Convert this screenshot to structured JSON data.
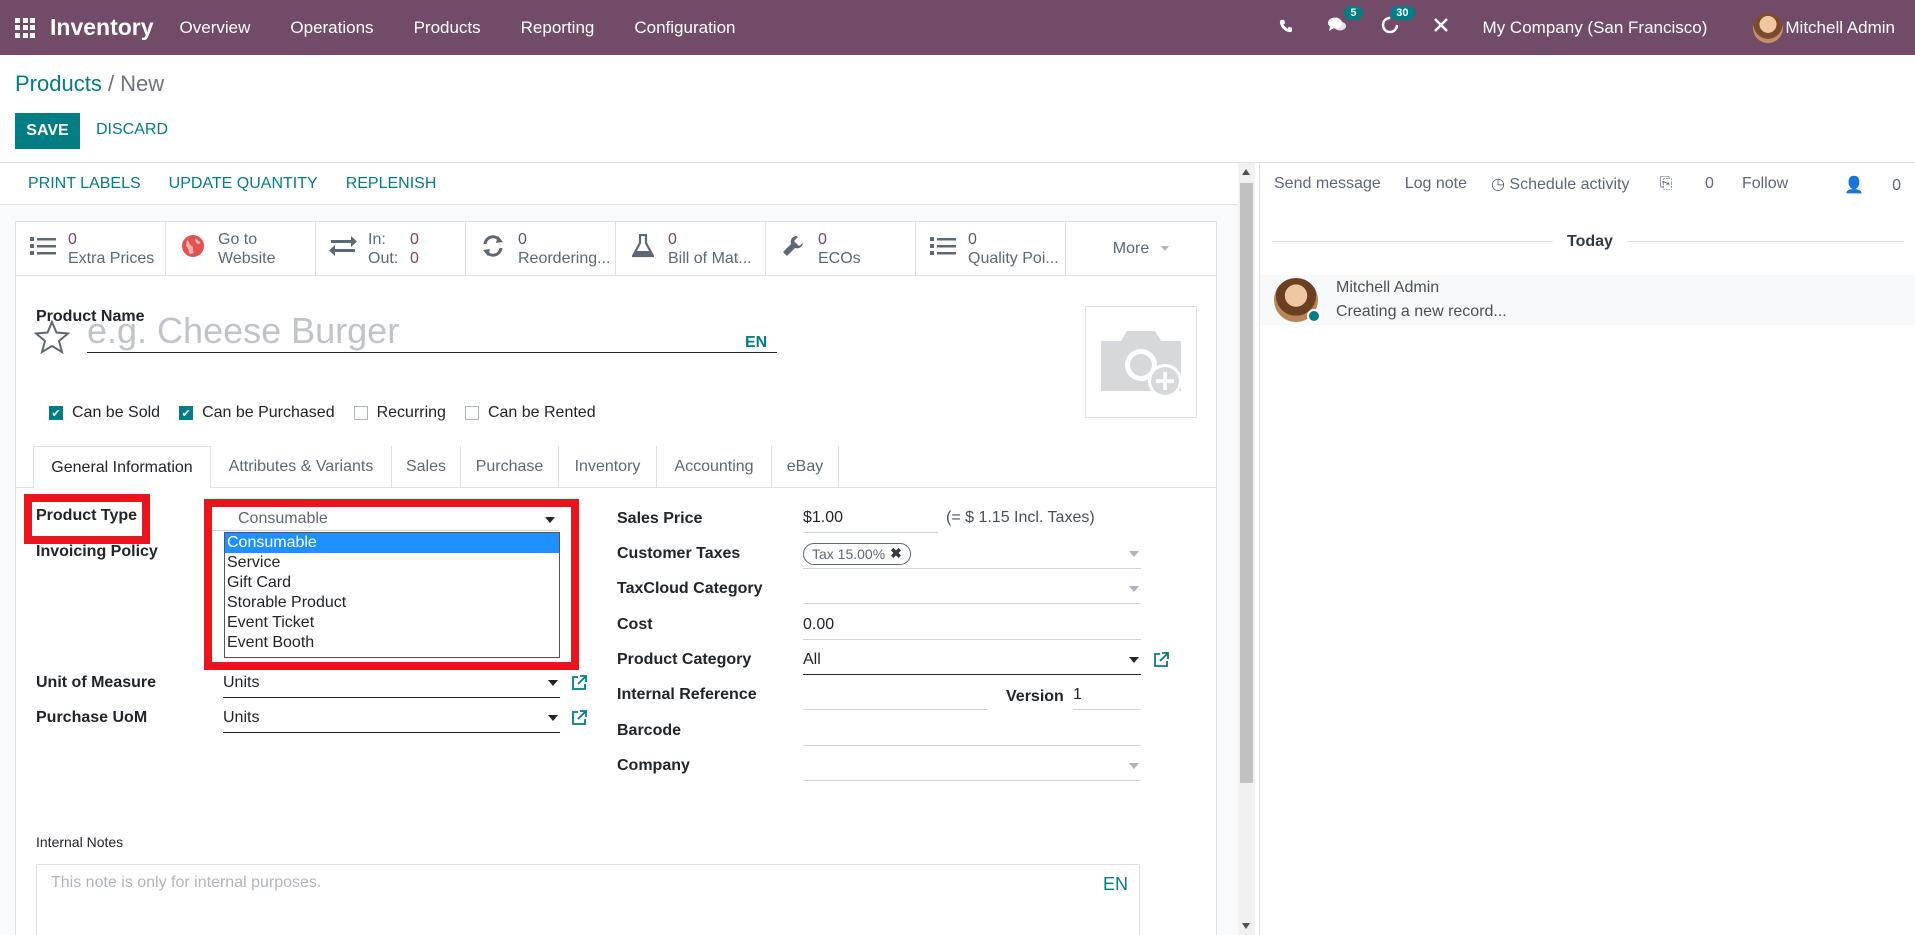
{
  "navbar": {
    "app_name": "Inventory",
    "menu": [
      "Overview",
      "Operations",
      "Products",
      "Reporting",
      "Configuration"
    ],
    "messages_count": "5",
    "activities_count": "30",
    "company": "My Company (San Francisco)",
    "user": "Mitchell Admin",
    "bg_color": "#714b67"
  },
  "breadcrumb": {
    "parent": "Products",
    "separator": " / ",
    "current": "New"
  },
  "buttons": {
    "save": "SAVE",
    "discard": "DISCARD"
  },
  "statusbar": {
    "print_labels": "PRINT LABELS",
    "update_quantity": "UPDATE QUANTITY",
    "replenish": "REPLENISH"
  },
  "smart_buttons": {
    "extra_prices": {
      "value": "0",
      "label": "Extra Prices"
    },
    "website": {
      "line1": "Go to",
      "line2": "Website"
    },
    "inout": {
      "in_label": "In:",
      "in_value": "0",
      "out_label": "Out:",
      "out_value": "0"
    },
    "reordering": {
      "value": "0",
      "label": "Reordering..."
    },
    "bom": {
      "value": "0",
      "label": "Bill of Mat..."
    },
    "ecos": {
      "value": "0",
      "label": "ECOs"
    },
    "quality": {
      "value": "0",
      "label": "Quality Poi..."
    },
    "more": "More"
  },
  "form": {
    "product_name_label": "Product Name",
    "product_name_placeholder": "e.g. Cheese Burger",
    "lang": "EN",
    "checkboxes": [
      {
        "label": "Can be Sold",
        "checked": true
      },
      {
        "label": "Can be Purchased",
        "checked": true
      },
      {
        "label": "Recurring",
        "checked": false
      },
      {
        "label": "Can be Rented",
        "checked": false
      }
    ],
    "tabs": [
      "General Information",
      "Attributes & Variants",
      "Sales",
      "Purchase",
      "Inventory",
      "Accounting",
      "eBay"
    ],
    "left": {
      "product_type_label": "Product Type",
      "product_type_value": "Consumable",
      "product_type_options": [
        "Consumable",
        "Service",
        "Gift Card",
        "Storable Product",
        "Event Ticket",
        "Event Booth"
      ],
      "invoicing_policy_label": "Invoicing Policy",
      "uom_label": "Unit of Measure",
      "uom_value": "Units",
      "purchase_uom_label": "Purchase UoM",
      "purchase_uom_value": "Units"
    },
    "right": {
      "sales_price_label": "Sales Price",
      "sales_price_value": "$1.00",
      "sales_price_incl": "(= $ 1.15 Incl. Taxes)",
      "customer_taxes_label": "Customer Taxes",
      "customer_taxes_tag": "Tax 15.00%",
      "taxcloud_label": "TaxCloud Category",
      "cost_label": "Cost",
      "cost_value": "0.00",
      "category_label": "Product Category",
      "category_value": "All",
      "internal_ref_label": "Internal Reference",
      "version_label": "Version",
      "version_value": "1",
      "barcode_label": "Barcode",
      "company_label": "Company"
    },
    "internal_notes_label": "Internal Notes",
    "internal_notes_placeholder": "This note is only for internal purposes.",
    "highlight_color": "#e8151d"
  },
  "chatter": {
    "send_message": "Send message",
    "log_note": "Log note",
    "schedule_activity": "Schedule activity",
    "attachments": "0",
    "follow": "Follow",
    "followers": "0",
    "today": "Today",
    "message_author": "Mitchell Admin",
    "message_body": "Creating a new record..."
  }
}
